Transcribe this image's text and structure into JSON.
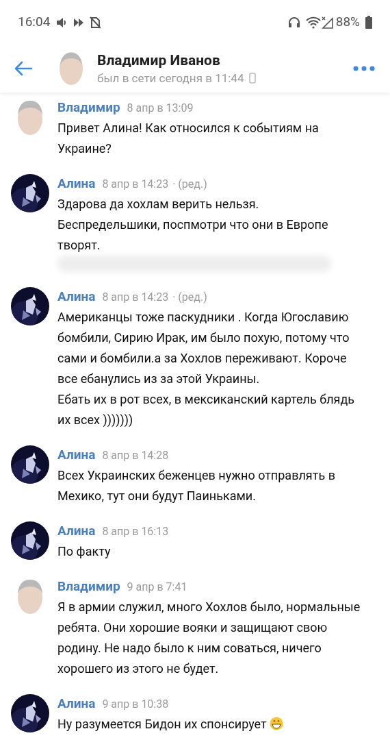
{
  "status_bar": {
    "time": "16:04",
    "battery": "88%"
  },
  "header": {
    "title": "Владимир Иванов",
    "subtitle": "был в сети сегодня в 11:44"
  },
  "messages": [
    {
      "author": "Владимир",
      "kind": "vladimir",
      "date": "8 апр в 13:09",
      "lines": [
        "Привет Алина! Как относился к событиям на Украине?"
      ]
    },
    {
      "author": "Алина",
      "kind": "alina",
      "date": "8 апр в 14:23",
      "edited": "· (ред.)",
      "lines": [
        "Здарова да хохлам верить нельзя.",
        "Беспредельшики, поспмотри что они в Европе творят."
      ],
      "redacted": true
    },
    {
      "author": "Алина",
      "kind": "alina",
      "date": "8 апр в 14:23",
      "edited": "· (ред.)",
      "lines": [
        "Американцы тоже паскудники . Когда Югославию бомбили, Сирию Ирак, им было похую, потому что сами и бомбили.а за Хохлов переживают. Короче все ебанулись из за этой Украины.",
        "Ебать их в рот всех, в мексиканский картель блядь их всех )))))))"
      ]
    },
    {
      "author": "Алина",
      "kind": "alina",
      "date": "8 апр в 14:28",
      "lines": [
        "Всех Украинских беженцев нужно отправлять в Мехико, тут они будут Паиньками."
      ]
    },
    {
      "author": "Алина",
      "kind": "alina",
      "date": "8 апр в 16:13",
      "lines": [
        "По факту"
      ]
    },
    {
      "author": "Владимир",
      "kind": "vladimir",
      "date": "9 апр в 7:41",
      "lines": [
        "Я в армии служил, много Хохлов было, нормальные ребята. Они хорошие вояки и защищают свою родину. Не надо было к ним соваться, ничего хорошего из этого не будет."
      ]
    },
    {
      "author": "Алина",
      "kind": "alina",
      "date": "9 апр в 10:38",
      "lines": [
        "Ну разумеется Бидон их спонсирует"
      ],
      "emoji": {
        "kind": "grin"
      }
    }
  ]
}
